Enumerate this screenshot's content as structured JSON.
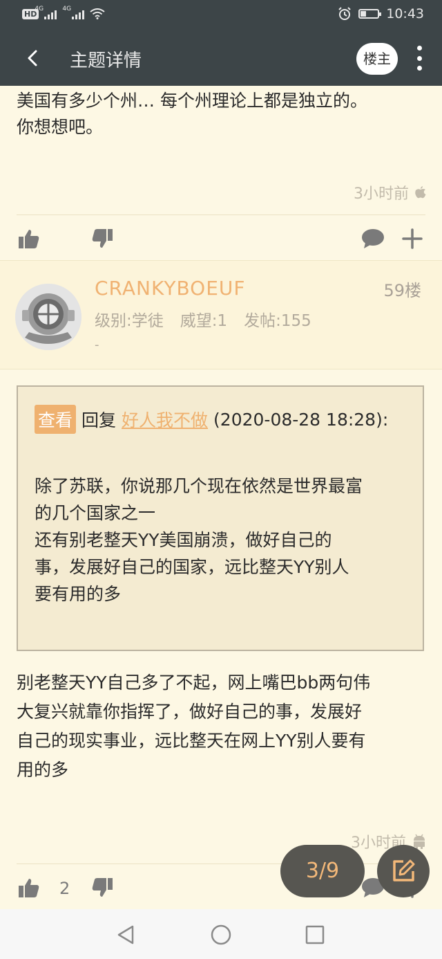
{
  "status_bar": {
    "hd": "HD",
    "net1": "4G",
    "net2": "4G",
    "time": "10:43"
  },
  "header": {
    "title": "主题详情",
    "owner_button": "楼主"
  },
  "post1": {
    "lines": [
      "美国有多少个州… 每个州理论上都是独立的。",
      "你想想吧。"
    ],
    "time": "3小时前"
  },
  "post2": {
    "username": "CRANKYBOEUF",
    "floor": "59楼",
    "level": "级别:学徒",
    "prestige": "威望:1",
    "posts": "发帖:155",
    "dash": "-",
    "quote": {
      "badge": "查看",
      "reply_label": "回复",
      "quoted_user": "好人我不做",
      "datetime": "(2020-08-28 18:28):",
      "lines": [
        "除了苏联，你说那几个现在依然是世界最富",
        "的几个国家之一",
        "还有别老整天YY美国崩溃，做好自己的",
        "事，发展好自己的国家，远比整天YY别人",
        "要有用的多"
      ]
    },
    "lines": [
      "别老整天YY自己多了不起，网上嘴巴bb两句伟",
      "大复兴就靠你指挥了，做好自己的事，发展好",
      "自己的现实事业，远比整天在网上YY别人要有",
      "用的多"
    ],
    "time": "3小时前",
    "like_count": "2"
  },
  "pager": "3/9",
  "icons": {
    "back": "back-arrow-icon",
    "more": "more-vertical-icon",
    "like": "thumbs-up-icon",
    "dislike": "thumbs-down-icon",
    "comment": "comment-bubble-icon",
    "add": "plus-icon",
    "apple": "apple-icon",
    "android": "android-icon",
    "edit": "edit-icon"
  },
  "colors": {
    "app_bar": "#3d4548",
    "page_bg": "#fdf8e4",
    "accent_orange": "#efb16f",
    "fab_bg": "#575651"
  }
}
